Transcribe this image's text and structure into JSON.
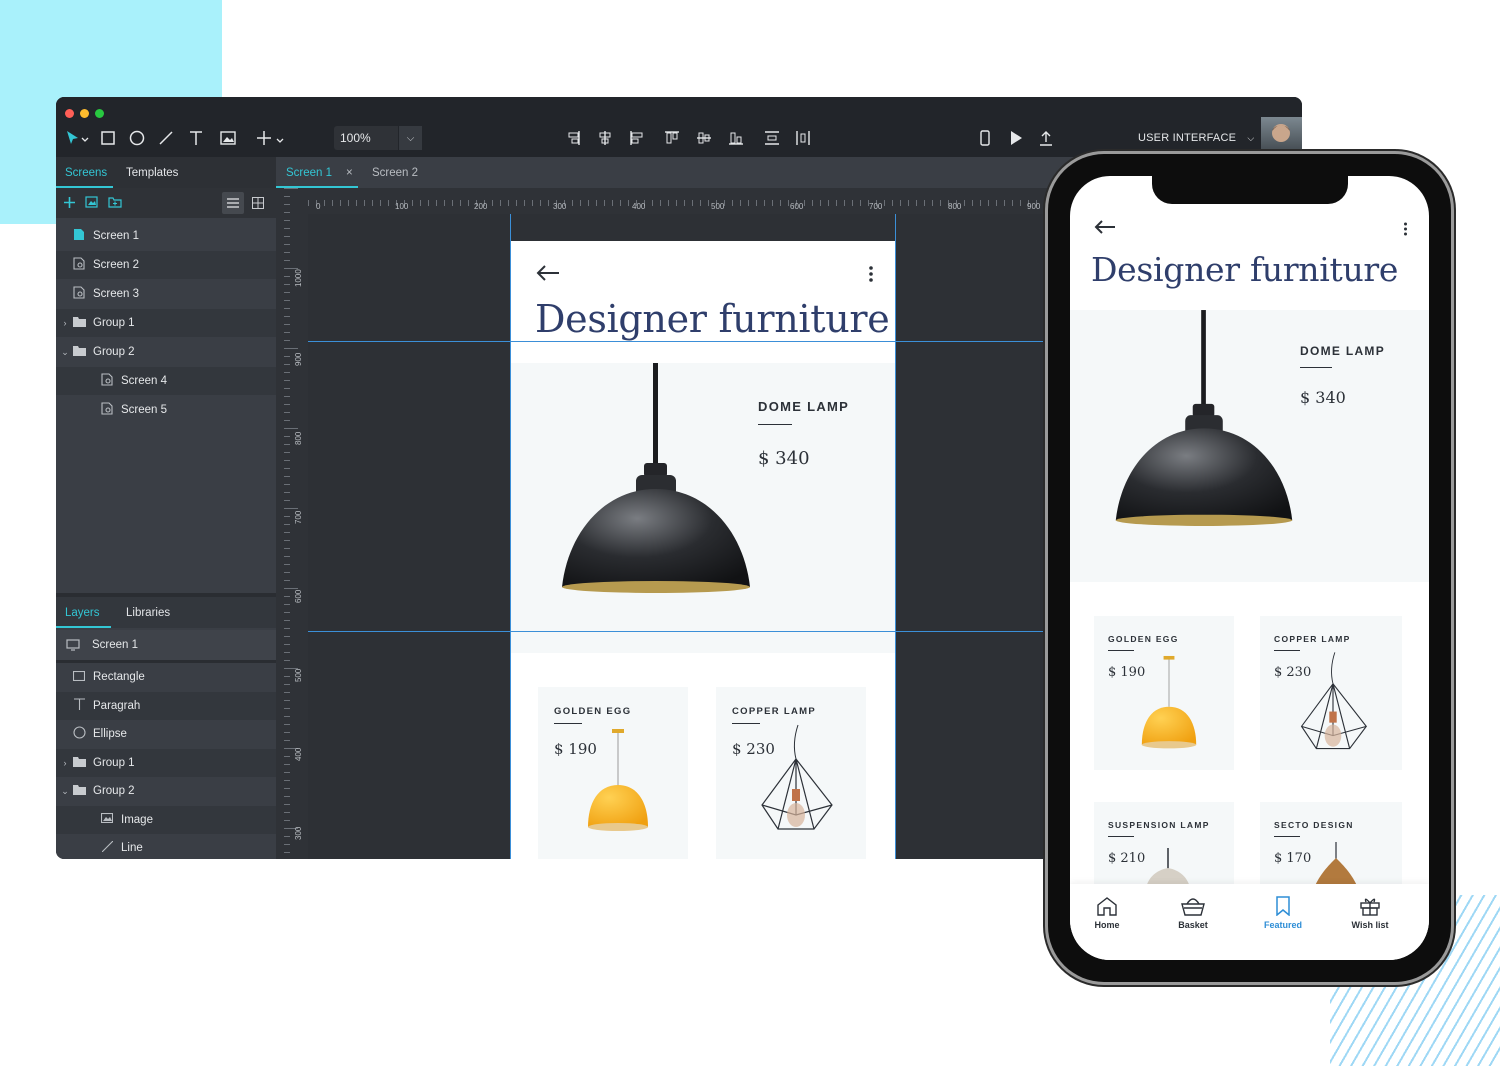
{
  "toolbar": {
    "zoom": "100%",
    "mode_label": "USER INTERFACE",
    "tools": [
      "pointer-icon",
      "rectangle-icon",
      "ellipse-icon",
      "line-icon",
      "text-icon",
      "image-icon",
      "add-icon"
    ],
    "align_tools": [
      "align-right-icon",
      "align-center-h-icon",
      "align-left-icon",
      "align-top-icon",
      "align-middle-icon",
      "align-bottom-icon",
      "distribute-v-icon",
      "distribute-h-icon"
    ],
    "right_tools": [
      "mobile-preview-icon",
      "play-icon",
      "export-icon"
    ]
  },
  "screens_panel": {
    "tabs": [
      "Screens",
      "Templates"
    ],
    "items": [
      {
        "label": "Screen 1",
        "type": "screen-active",
        "indent": 0
      },
      {
        "label": "Screen 2",
        "type": "screen",
        "indent": 0
      },
      {
        "label": "Screen 3",
        "type": "screen",
        "indent": 0
      },
      {
        "label": "Group 1",
        "type": "group-collapsed",
        "indent": 0
      },
      {
        "label": "Group 2",
        "type": "group-expanded",
        "indent": 0
      },
      {
        "label": "Screen 4",
        "type": "screen",
        "indent": 1
      },
      {
        "label": "Screen 5",
        "type": "screen",
        "indent": 1
      }
    ]
  },
  "layers_panel": {
    "tabs": [
      "Layers",
      "Libraries"
    ],
    "root": "Screen 1",
    "items": [
      {
        "label": "Rectangle",
        "type": "rectangle",
        "indent": 0
      },
      {
        "label": "Paragrah",
        "type": "text",
        "indent": 0
      },
      {
        "label": "Ellipse",
        "type": "ellipse",
        "indent": 0
      },
      {
        "label": "Group 1",
        "type": "group-collapsed",
        "indent": 0
      },
      {
        "label": "Group 2",
        "type": "group-expanded",
        "indent": 0
      },
      {
        "label": "Image",
        "type": "image",
        "indent": 1
      },
      {
        "label": "Line",
        "type": "line",
        "indent": 1
      }
    ]
  },
  "canvas_tabs": [
    {
      "label": "Screen 1",
      "active": true,
      "close": "×"
    },
    {
      "label": "Screen 2",
      "active": false
    }
  ],
  "ruler": {
    "horizontal": [
      "0",
      "100",
      "200",
      "300",
      "400",
      "500",
      "600",
      "700",
      "800",
      "900"
    ],
    "vertical": [
      "1000",
      "900",
      "800",
      "700",
      "600",
      "500",
      "400",
      "300"
    ]
  },
  "design": {
    "title": "Designer furniture",
    "hero": {
      "name": "DOME LAMP",
      "price": "$ 340"
    },
    "products": [
      {
        "name": "GOLDEN EGG",
        "price": "$ 190"
      },
      {
        "name": "COPPER LAMP",
        "price": "$ 230"
      },
      {
        "name": "SUSPENSION LAMP",
        "price": "$ 210"
      },
      {
        "name": "SECTO DESIGN",
        "price": "$ 170"
      }
    ],
    "nav": [
      {
        "label": "Home",
        "icon": "home-icon",
        "active": false
      },
      {
        "label": "Basket",
        "icon": "basket-icon",
        "active": false
      },
      {
        "label": "Featured",
        "icon": "bookmark-icon",
        "active": true
      },
      {
        "label": "Wish list",
        "icon": "gift-icon",
        "active": false
      }
    ]
  },
  "colors": {
    "accent": "#33c6d4",
    "title": "#2f3e6b",
    "nav_active": "#2e8ed6",
    "guides": "#3b8fd8"
  }
}
